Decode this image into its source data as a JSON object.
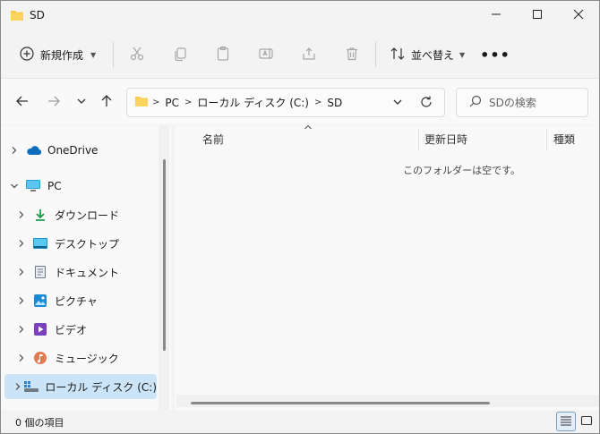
{
  "window": {
    "title": "SD",
    "icon": "folder-icon"
  },
  "titlebar_controls": {
    "minimize_icon": "minimize-icon",
    "maximize_icon": "maximize-icon",
    "close_icon": "close-icon"
  },
  "toolbar": {
    "new_label": "新規作成",
    "sort_label": "並べ替え",
    "actions": [
      "cut-icon",
      "copy-icon",
      "paste-icon",
      "rename-icon",
      "share-icon",
      "delete-icon",
      "more-icon"
    ]
  },
  "address": {
    "crumbs": [
      "PC",
      "ローカル ディスク (C:)",
      "SD"
    ]
  },
  "search": {
    "placeholder": "SDの検索"
  },
  "sidebar": {
    "items": [
      {
        "label": "OneDrive",
        "icon": "onedrive-icon"
      },
      {
        "label": "PC",
        "icon": "pc-icon"
      },
      {
        "label": "ダウンロード",
        "icon": "download-icon"
      },
      {
        "label": "デスクトップ",
        "icon": "desktop-icon"
      },
      {
        "label": "ドキュメント",
        "icon": "documents-icon"
      },
      {
        "label": "ピクチャ",
        "icon": "pictures-icon"
      },
      {
        "label": "ビデオ",
        "icon": "videos-icon"
      },
      {
        "label": "ミュージック",
        "icon": "music-icon"
      },
      {
        "label": "ローカル ディスク (C:)",
        "icon": "drive-icon",
        "selected": true
      }
    ]
  },
  "content": {
    "columns": [
      "名前",
      "更新日時",
      "種類"
    ],
    "empty_message": "このフォルダーは空です。"
  },
  "status": {
    "item_count": "0 個の項目"
  },
  "colors": {
    "accent": "#0067c0",
    "selected_bg": "#cce4f7",
    "folder_yellow": "#f7c948"
  }
}
